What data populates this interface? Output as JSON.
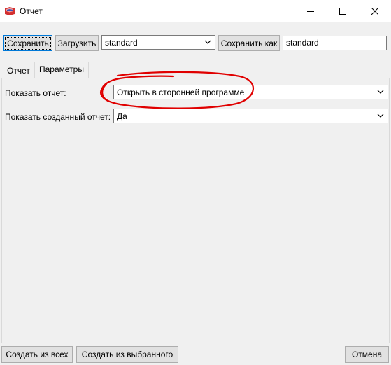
{
  "window": {
    "title": "Отчет",
    "controls": {
      "minimize": "minimize-icon",
      "maximize": "maximize-icon",
      "close": "close-icon"
    }
  },
  "toolbar": {
    "save_label": "Сохранить",
    "load_label": "Загрузить",
    "profile_select_value": "standard",
    "save_as_label": "Сохранить как",
    "save_as_value": "standard"
  },
  "tabs": [
    {
      "label": "Отчет",
      "selected": false
    },
    {
      "label": "Параметры",
      "selected": true
    }
  ],
  "params": {
    "show_report_label": "Показать отчет:",
    "show_report_value": "Открыть в сторонней программе",
    "show_created_label": "Показать созданный отчет:",
    "show_created_value": "Да"
  },
  "footer": {
    "create_all_label": "Создать из всех",
    "create_selected_label": "Создать из выбранного",
    "cancel_label": "Отмена"
  },
  "colors": {
    "accent": "#0078d7",
    "annotation": "#e00000"
  }
}
